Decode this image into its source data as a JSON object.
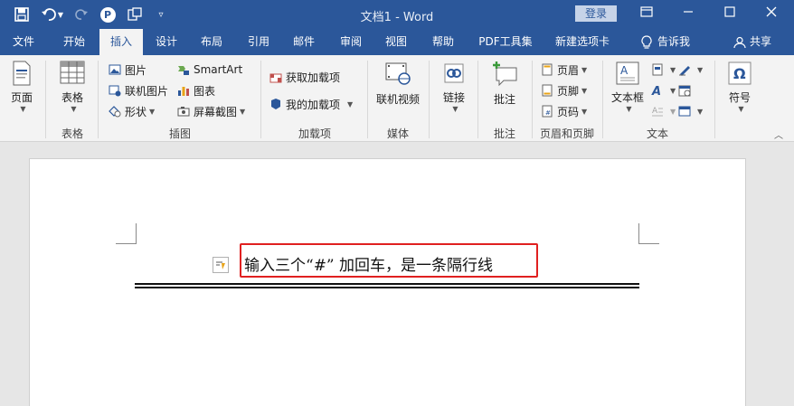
{
  "titlebar": {
    "title": "文档1  -  Word",
    "login": "登录",
    "avatar_letter": "P"
  },
  "tabs": [
    "文件",
    "开始",
    "插入",
    "设计",
    "布局",
    "引用",
    "邮件",
    "审阅",
    "视图",
    "帮助",
    "PDF工具集",
    "新建选项卡"
  ],
  "active_tab": "插入",
  "tell_me": "告诉我",
  "share": "共享",
  "ribbon": {
    "pages": {
      "label": "页面",
      "group": ""
    },
    "tables": {
      "label": "表格",
      "group": "表格"
    },
    "illustrations": {
      "group": "插图",
      "picture": "图片",
      "online_picture": "联机图片",
      "shapes": "形状",
      "smartart": "SmartArt",
      "chart": "图表",
      "screenshot": "屏幕截图"
    },
    "addins": {
      "group": "加载项",
      "get": "获取加载项",
      "my": "我的加载项"
    },
    "media": {
      "group": "媒体",
      "video": "联机视频"
    },
    "links": {
      "label": "链接"
    },
    "comments": {
      "group": "批注",
      "comment": "批注"
    },
    "header_footer": {
      "group": "页眉和页脚",
      "header": "页眉",
      "footer": "页脚",
      "page_number": "页码"
    },
    "text": {
      "group": "文本",
      "textbox": "文本框"
    },
    "symbols": {
      "label": "符号"
    }
  },
  "document": {
    "text": "输入三个“#” 加回车，是一条隔行线"
  },
  "colors": {
    "brand": "#2b579a",
    "highlight": "#e02020"
  }
}
